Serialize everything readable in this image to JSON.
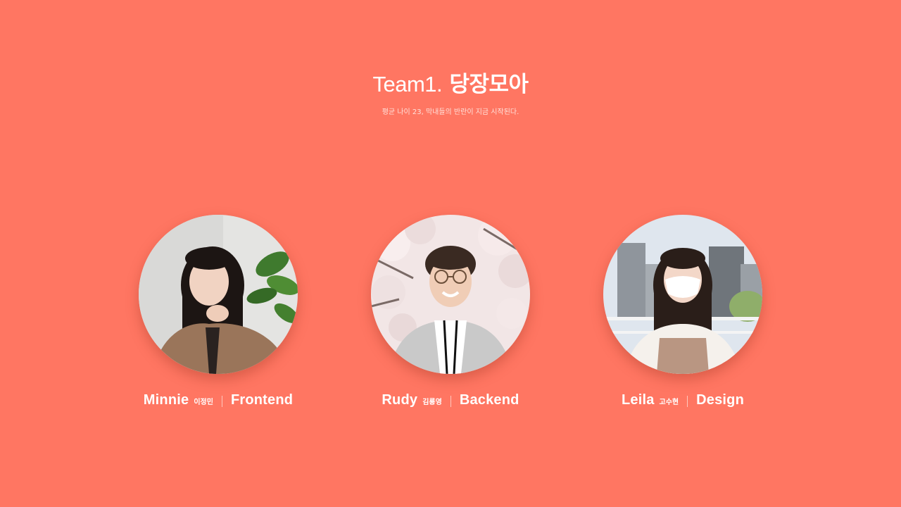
{
  "header": {
    "team_label": "Team1.",
    "team_name": "당장모아",
    "subtitle": "평균 나이 23, 막내들의 반란이 지금 시작된다."
  },
  "members": [
    {
      "name": "Minnie",
      "korean_name": "이정민",
      "role": "Frontend"
    },
    {
      "name": "Rudy",
      "korean_name": "김룡영",
      "role": "Backend"
    },
    {
      "name": "Leila",
      "korean_name": "고수현",
      "role": "Design"
    }
  ],
  "colors": {
    "background": "#ff7662",
    "text": "#ffffff",
    "divider": "#ffc7bd"
  }
}
